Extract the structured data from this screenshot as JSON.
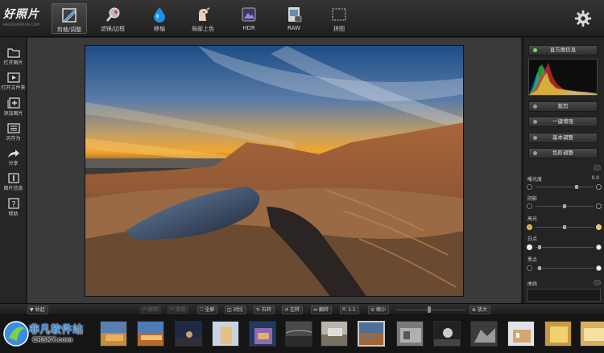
{
  "app": {
    "name": "好照片",
    "subtitle": "HAOZHAOPIAN.COM"
  },
  "toolbar": {
    "tools": [
      {
        "label": "剪裁/调整",
        "icon": "crop-pencil-icon",
        "active": true
      },
      {
        "label": "滤镜/边框",
        "icon": "filter-paintbucket-icon",
        "active": false
      },
      {
        "label": "移轴",
        "icon": "droplet-icon",
        "active": false
      },
      {
        "label": "局部上色",
        "icon": "dog-paint-icon",
        "active": false
      },
      {
        "label": "HDR",
        "icon": "hdr-icon",
        "active": false
      },
      {
        "label": "RAW",
        "icon": "raw-file-icon",
        "active": false
      },
      {
        "label": "拼图",
        "icon": "collage-icon",
        "active": false
      }
    ],
    "settings_icon": "gear-icon"
  },
  "sidebar": {
    "items": [
      {
        "label": "打开图片",
        "icon": "folder-icon"
      },
      {
        "label": "打开文件夹",
        "icon": "folder-play-icon"
      },
      {
        "label": "添加图片",
        "icon": "add-image-icon"
      },
      {
        "label": "另存为",
        "icon": "save-as-icon"
      },
      {
        "label": "分享",
        "icon": "share-icon"
      },
      {
        "label": "图片信息",
        "icon": "info-icon"
      },
      {
        "label": "帮助",
        "icon": "help-icon"
      }
    ]
  },
  "panel": {
    "histogram_button": "直方图信息",
    "buttons": [
      "裁剪",
      "一键增强",
      "基本调整",
      "色阶调整"
    ],
    "sliders": [
      {
        "label": "曝光度",
        "value": "0.0",
        "position": 0.72
      },
      {
        "label": "阴影",
        "value": "",
        "position": 0.5
      },
      {
        "label": "高光",
        "value": "",
        "position": 0.5
      },
      {
        "label": "白点",
        "value": "",
        "position": 0.05
      },
      {
        "label": "黑点",
        "value": "",
        "position": 0.05
      }
    ],
    "curve_label": "曲线"
  },
  "bottombar": {
    "collapse": "收起",
    "undo": "撤销",
    "redo": "重做",
    "fullscreen": "全屏",
    "compare": "对比",
    "rotate_right": "右转",
    "rotate_left": "左转",
    "flip": "翻转",
    "actual_size": "1:1",
    "zoom_out": "缩小",
    "zoom_in": "放大",
    "zoom_position": 0.47
  },
  "filmstrip": {
    "selected_index": 8,
    "count": 14
  },
  "watermark": {
    "line1": "非凡软件站",
    "line2": "CRSKY.com"
  },
  "colors": {
    "accent_green": "#6ee05a",
    "selection": "#c9c9c9",
    "brand_blue": "#2a7fd4"
  }
}
